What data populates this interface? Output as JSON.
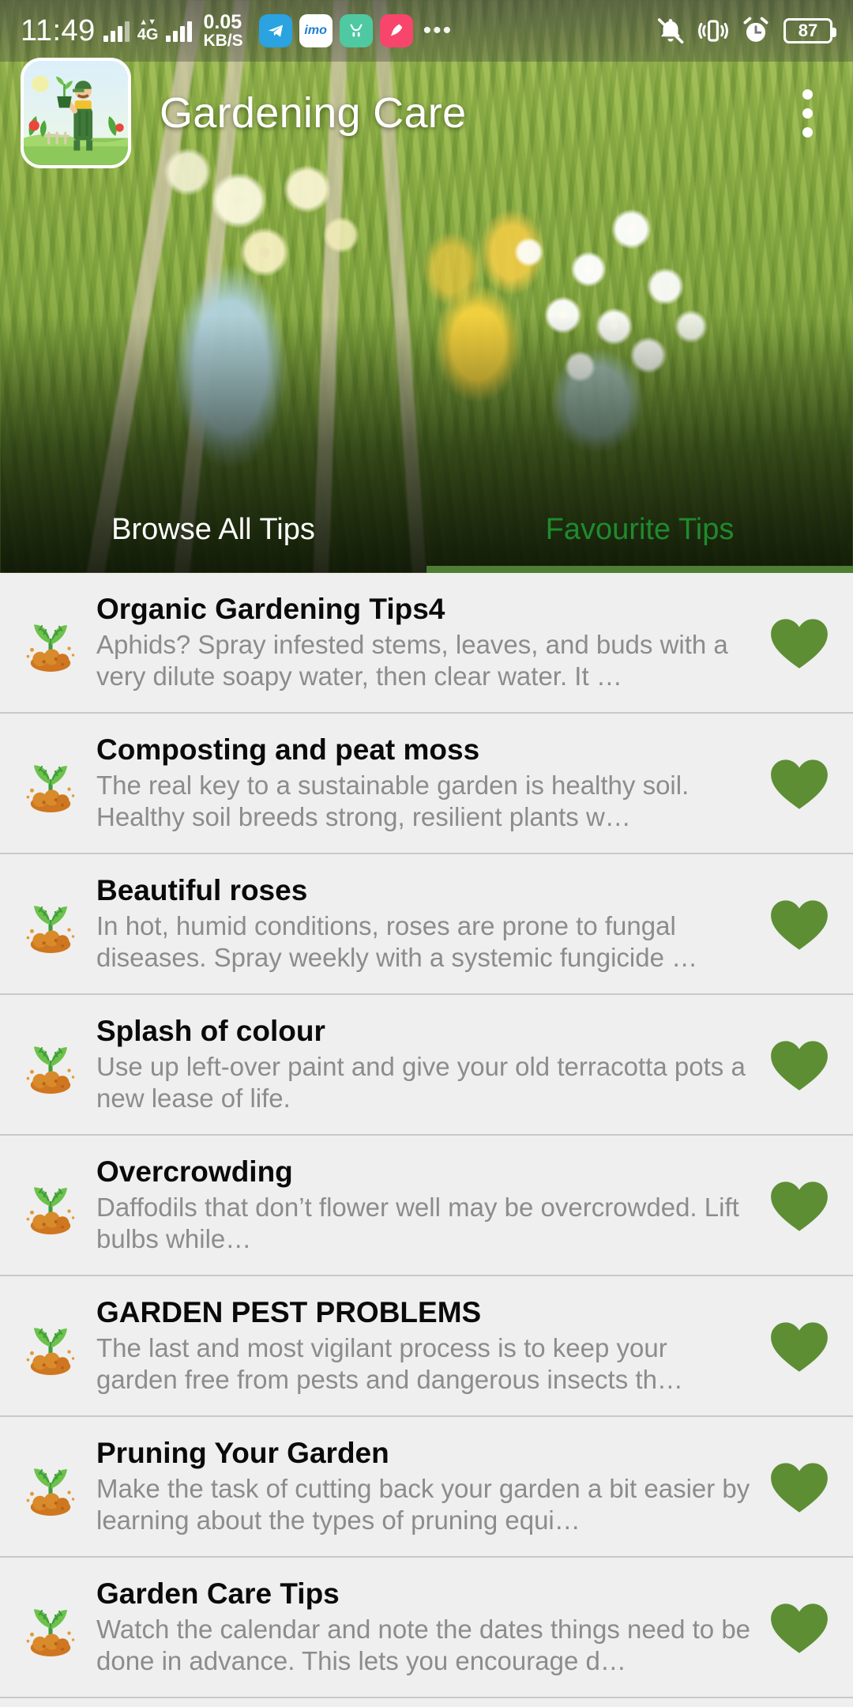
{
  "status_bar": {
    "time": "11:49",
    "network_type": "4G",
    "net_speed_value": "0.05",
    "net_speed_unit": "KB/S",
    "battery_level": "87",
    "icons": {
      "signal": "signal-bars-icon",
      "signal2": "signal-bars-4g-icon",
      "telegram": "telegram-app-icon",
      "imo": "imo-app-icon",
      "green_app": "green-app-icon",
      "red_app": "red-app-icon",
      "more": "more-apps-icon",
      "mute": "ringer-muted-icon",
      "vibrate": "vibrate-icon",
      "alarm": "alarm-clock-icon",
      "battery": "battery-icon"
    },
    "more_dots": "•••",
    "imo_label": "imo"
  },
  "app_bar": {
    "title": "Gardening Care",
    "logo_alt": "gardener-app-logo",
    "overflow_label": "overflow-menu"
  },
  "tabs": [
    {
      "label": "Browse All Tips",
      "state": "inactive-white"
    },
    {
      "label": "Favourite Tips",
      "state": "active-green"
    }
  ],
  "tips": [
    {
      "title": "Organic Gardening Tips4",
      "description": "Aphids? Spray infested stems, leaves, and buds with a very dilute soapy water, then clear water. It …",
      "favourite": true
    },
    {
      "title": "Composting and peat moss",
      "description": "The real key to a sustainable garden is healthy soil. Healthy soil breeds strong, resilient plants w…",
      "favourite": true
    },
    {
      "title": "Beautiful roses",
      "description": "In hot, humid conditions, roses are prone to fungal diseases. Spray weekly with a systemic fungicide …",
      "favourite": true
    },
    {
      "title": "Splash of colour",
      "description": "Use up left-over paint and give your old terracotta pots a new lease of life.",
      "favourite": true
    },
    {
      "title": "Overcrowding",
      "description": "Daffodils that don’t flower well may be overcrowded. Lift bulbs while…",
      "favourite": true
    },
    {
      "title": "GARDEN PEST PROBLEMS",
      "description": "The last and most vigilant process is to keep your garden free from pests and dangerous insects th…",
      "favourite": true
    },
    {
      "title": "Pruning Your Garden",
      "description": "Make the task of cutting back your garden a bit easier by learning about the types of pruning equi…",
      "favourite": true
    },
    {
      "title": "Garden Care Tips",
      "description": "Watch the calendar and note the dates things need to be done in advance. This lets you encourage d…",
      "favourite": true
    }
  ],
  "colors": {
    "favourite_heart": "#5d8e34",
    "tab_indicator": "#4e7d33",
    "tab_active_text": "#1f8a2e",
    "list_background": "#efefef",
    "title_text": "#0a0a0a",
    "desc_text": "#8c8c8c",
    "leaf_green": "#5fc45f",
    "soil_brown": "#cf7620"
  }
}
